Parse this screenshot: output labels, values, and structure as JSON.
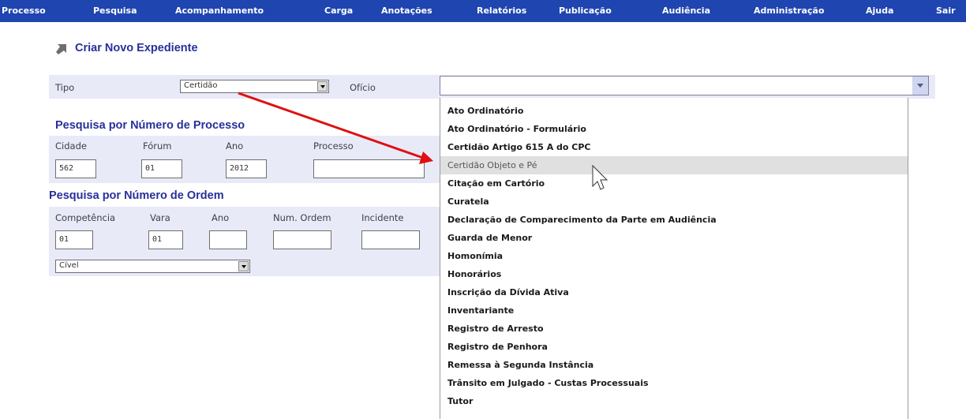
{
  "nav": {
    "items": [
      "Processo",
      "Pesquisa",
      "Acompanhamento",
      "Carga",
      "Anotações",
      "Relatórios",
      "Publicação",
      "Audiência",
      "Administração",
      "Ajuda",
      "Sair"
    ]
  },
  "page": {
    "title": "Criar Novo Expediente"
  },
  "form": {
    "tipo_label": "Tipo",
    "tipo_value": "Certidão",
    "oficio_label": "Ofício",
    "oficio_value": ""
  },
  "processo_section": {
    "title": "Pesquisa por Número de Processo",
    "cidade_label": "Cidade",
    "forum_label": "Fórum",
    "ano_label": "Ano",
    "processo_label": "Processo",
    "cidade_value": "562",
    "forum_value": "01",
    "ano_value": "2012",
    "processo_value": ""
  },
  "ordem_section": {
    "title": "Pesquisa por Número de Ordem",
    "competencia_label": "Competência",
    "vara_label": "Vara",
    "ano_label": "Ano",
    "num_ordem_label": "Num. Ordem",
    "incidente_label": "Incidente",
    "competencia_value": "01",
    "vara_value": "01",
    "ano_value": "",
    "num_ordem_value": "",
    "incidente_value": "",
    "tipo_value": "Cível"
  },
  "dropdown": {
    "highlighted_index": 3,
    "options": [
      "Ato Ordinatório",
      "Ato Ordinatório - Formulário",
      "Certidão Artigo 615 A do CPC",
      "Certidão Objeto e Pé",
      "Citação em Cartório",
      "Curatela",
      "Declaração de Comparecimento da Parte em Audiência",
      "Guarda de Menor",
      "Homonímia",
      "Honorários",
      "Inscrição da Dívida Ativa",
      "Inventariante",
      "Registro de Arresto",
      "Registro de Penhora",
      "Remessa à Segunda Instância",
      "Trânsito em Julgado - Custas Processuais",
      "Tutor"
    ]
  },
  "colors": {
    "nav_bg": "#1f45b0",
    "title": "#27309a",
    "band": "#e8eaf8",
    "annotation_arrow": "#e01010"
  },
  "icons": {
    "title_icon": "arrow-up-right-icon",
    "cursor": "mouse-pointer-icon",
    "annotation": "red-arrow-icon"
  }
}
